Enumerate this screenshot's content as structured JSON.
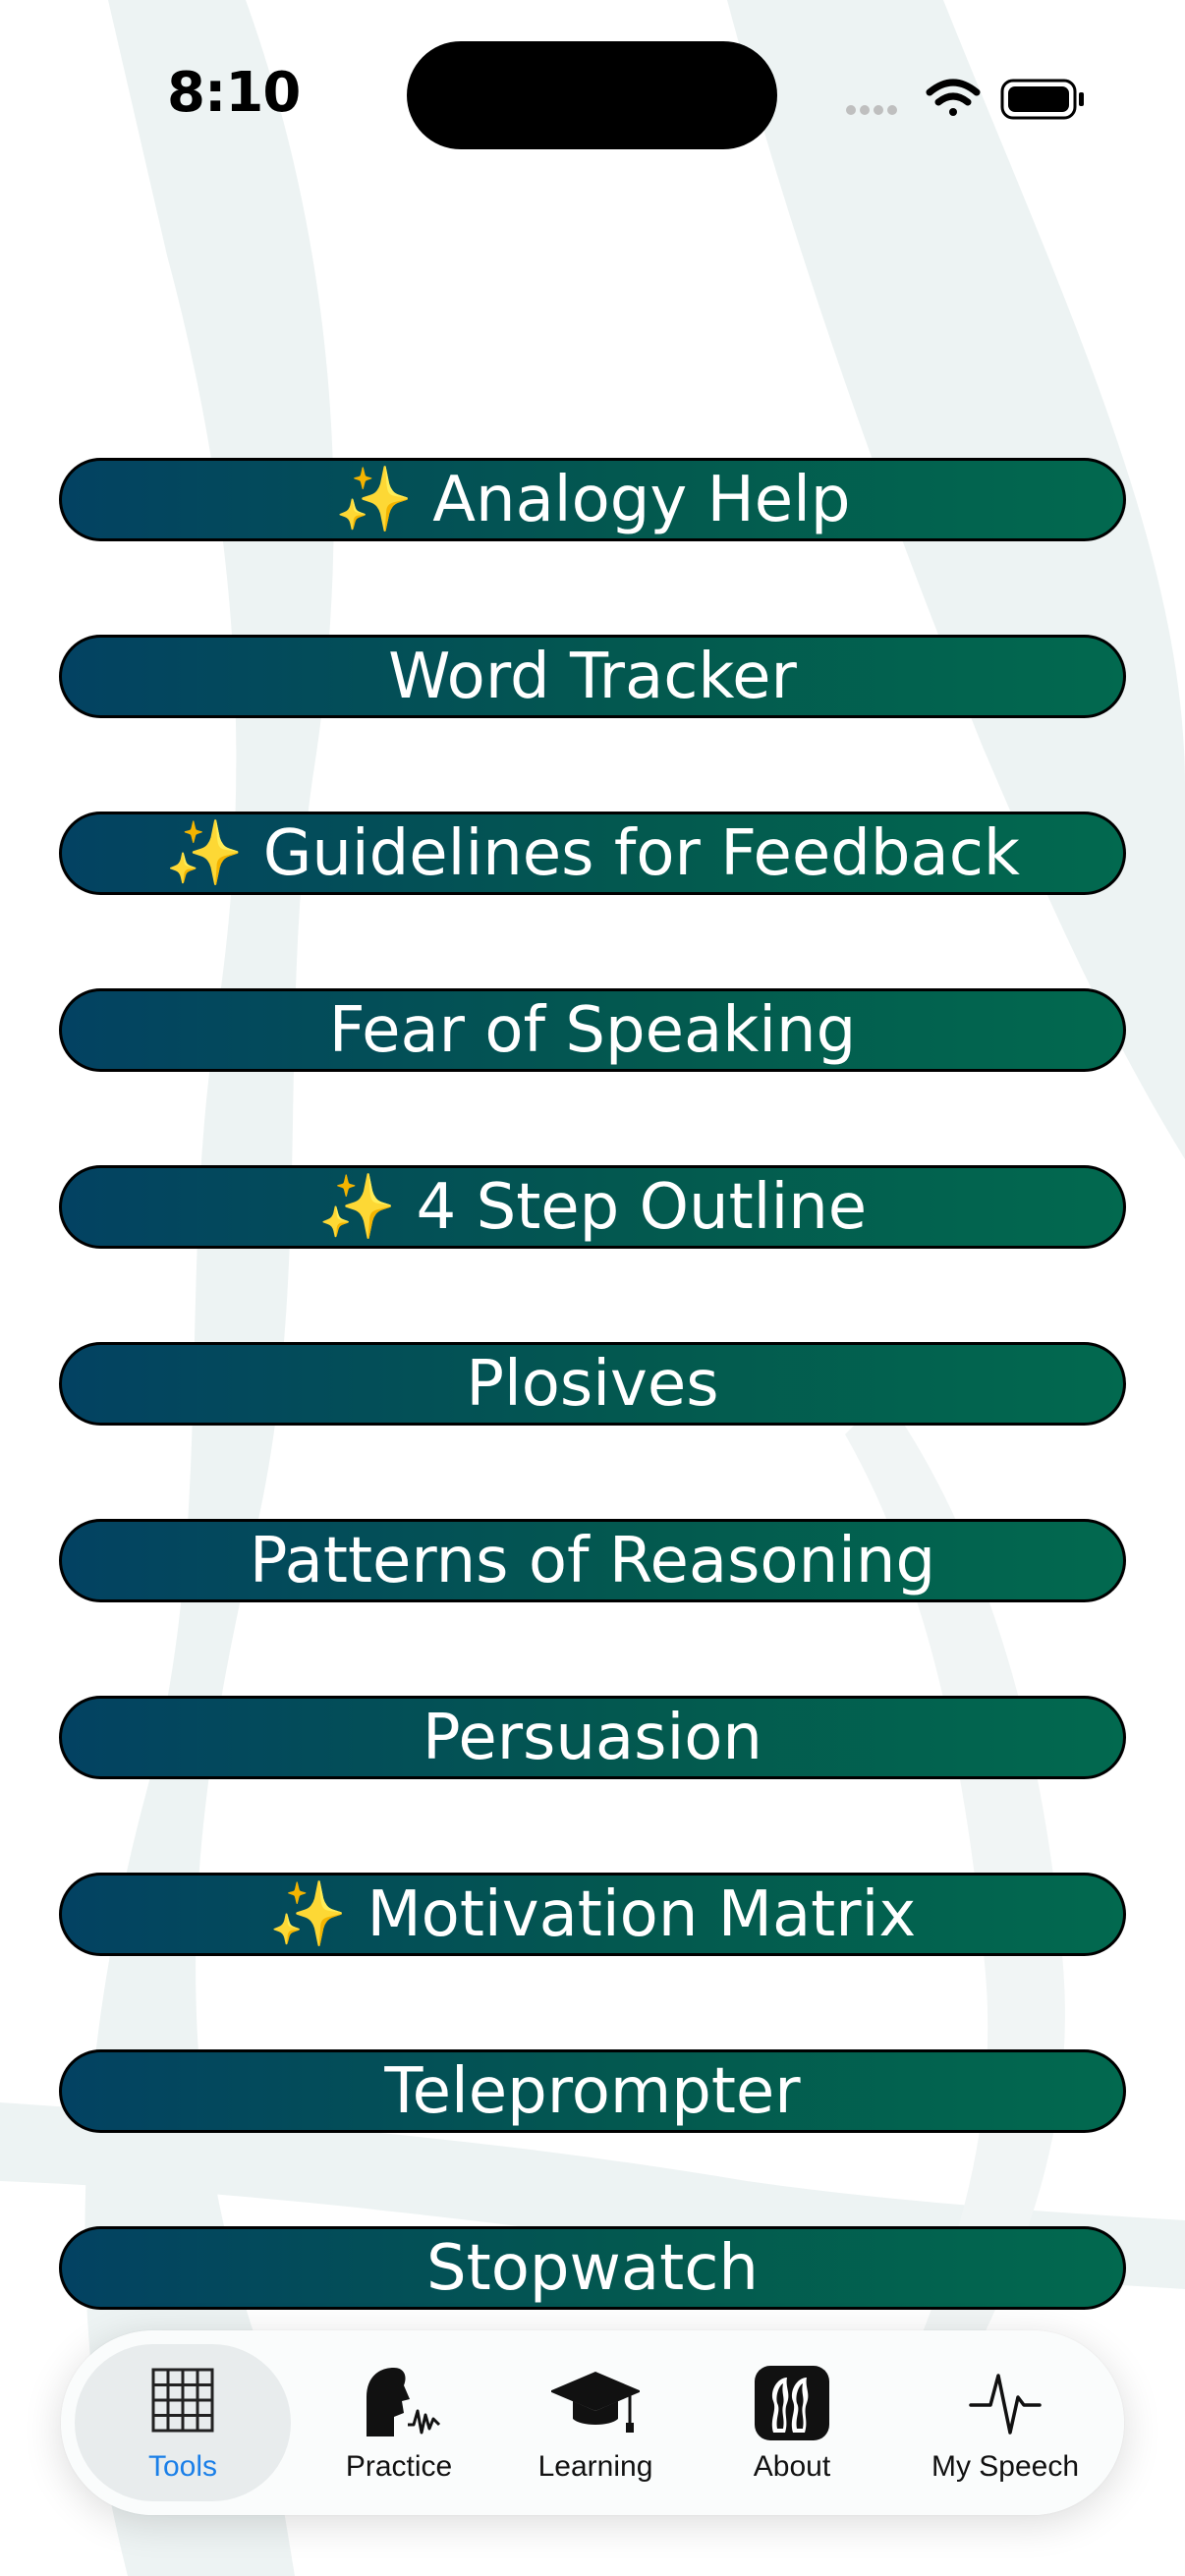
{
  "status_bar": {
    "time": "8:10",
    "signal_icon": "cellular-dots-icon",
    "wifi_icon": "wifi-icon",
    "battery_icon": "battery-icon"
  },
  "menu": {
    "items": [
      {
        "sparkle": "✨",
        "label": "Analogy Help"
      },
      {
        "sparkle": "",
        "label": "Word Tracker"
      },
      {
        "sparkle": "✨",
        "label": "Guidelines for Feedback"
      },
      {
        "sparkle": "",
        "label": "Fear of Speaking"
      },
      {
        "sparkle": "✨",
        "label": "4 Step Outline"
      },
      {
        "sparkle": "",
        "label": "Plosives"
      },
      {
        "sparkle": "",
        "label": "Patterns of Reasoning"
      },
      {
        "sparkle": "",
        "label": "Persuasion"
      },
      {
        "sparkle": "✨",
        "label": "Motivation Matrix"
      },
      {
        "sparkle": "",
        "label": "Teleprompter"
      },
      {
        "sparkle": "",
        "label": "Stopwatch"
      }
    ],
    "gradient_start": "#034262",
    "gradient_end": "#02694f",
    "text_color": "#ffffff"
  },
  "tabbar": {
    "tabs": [
      {
        "label": "Tools",
        "icon": "grid-icon",
        "active": true
      },
      {
        "label": "Practice",
        "icon": "speaking-head-icon",
        "active": false
      },
      {
        "label": "Learning",
        "icon": "graduation-cap-icon",
        "active": false
      },
      {
        "label": "About",
        "icon": "faces-icon",
        "active": false
      },
      {
        "label": "My Speech",
        "icon": "waveform-icon",
        "active": false
      }
    ],
    "active_color": "#1a7fe8"
  }
}
